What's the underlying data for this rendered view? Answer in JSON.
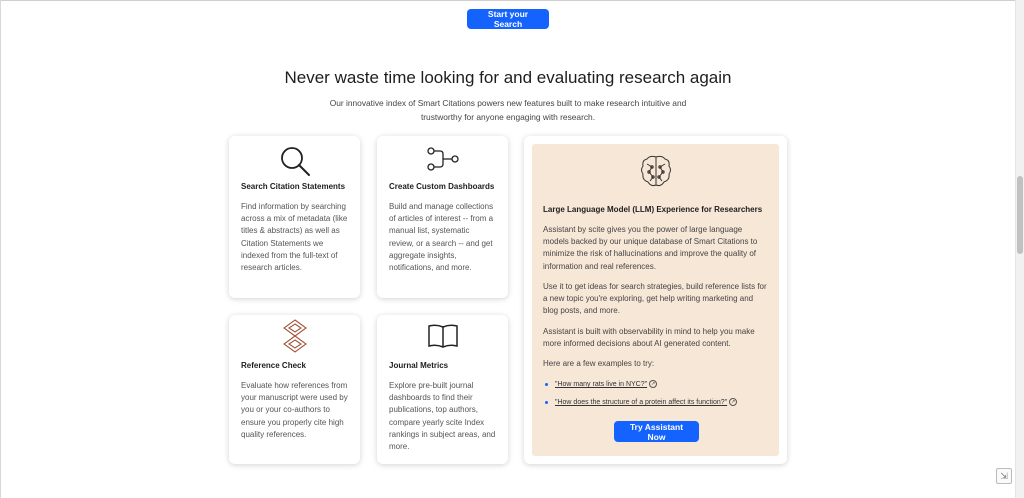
{
  "hero": {
    "start_button": "Start your Search"
  },
  "section": {
    "headline": "Never waste time looking for and evaluating research again",
    "subline": "Our innovative index of Smart Citations powers new features built to make research intuitive and trustworthy for anyone engaging with research."
  },
  "cards": {
    "search": {
      "icon": "magnifier-icon",
      "title": "Search Citation Statements",
      "body": "Find information by searching across a mix of metadata (like titles & abstracts) as well as Citation Statements we indexed from the full-text of research articles."
    },
    "dashboards": {
      "icon": "workflow-nodes-icon",
      "title": "Create Custom Dashboards",
      "body": "Build and manage collections of articles of interest -- from a manual list, systematic review, or a search -- and get aggregate insights, notifications, and more."
    },
    "reference": {
      "icon": "scite-logo-icon",
      "title": "Reference Check",
      "body": "Evaluate how references from your manuscript were used by you or your co-authors to ensure you properly cite high quality references."
    },
    "journal": {
      "icon": "open-book-icon",
      "title": "Journal Metrics",
      "body": "Explore pre-built journal dashboards to find their publications, top authors, compare yearly scite Index rankings in subject areas, and more."
    }
  },
  "llm": {
    "icon": "brain-icon",
    "title": "Large Language Model (LLM) Experience for Researchers",
    "p1": "Assistant by scite gives you the power of large language models backed by our unique database of Smart Citations to minimize the risk of hallucinations and improve the quality of information and real references.",
    "p2": "Use it to get ideas for search strategies, build reference lists for a new topic you're exploring, get help writing marketing and blog posts, and more.",
    "p3": "Assistant is built with observability in mind to help you make more informed decisions about AI generated content.",
    "p4": "Here are a few examples to try:",
    "examples": [
      "\"How many rats live in NYC?\"",
      "\"How does the structure of a protein affect its function?\""
    ],
    "button": "Try Assistant Now"
  },
  "colors": {
    "primary": "#1463ff",
    "llm_bg": "#f7e7d7",
    "accent_brown": "#a0563b"
  }
}
